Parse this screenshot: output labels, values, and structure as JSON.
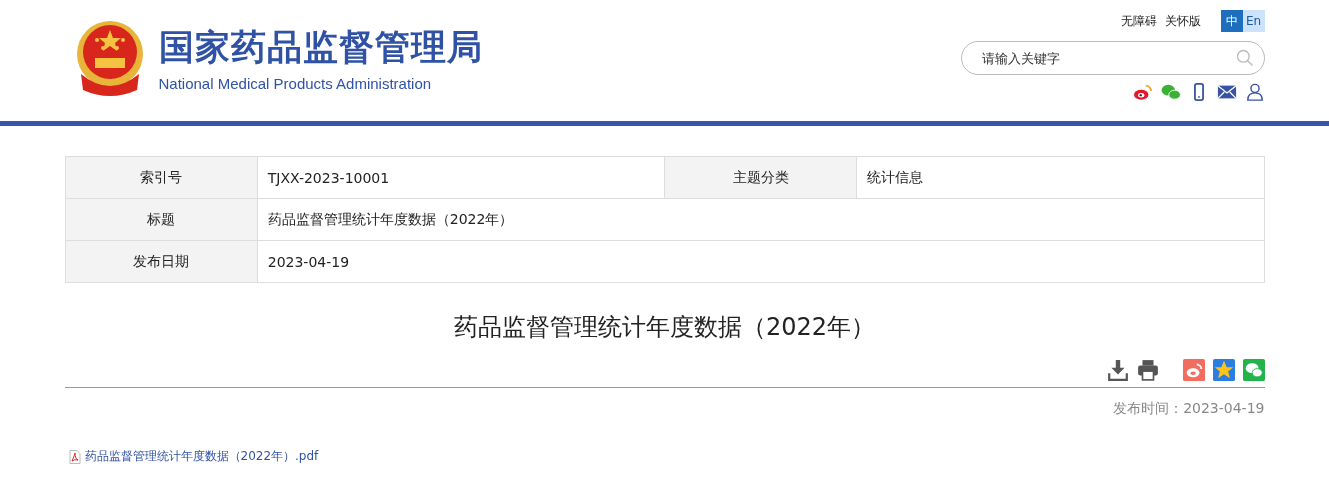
{
  "header": {
    "title": "国家药品监督管理局",
    "subtitle": "National Medical Products Administration",
    "links": [
      "无障碍",
      "关怀版"
    ],
    "languages": [
      {
        "label": "中",
        "selected": true
      },
      {
        "label": "En",
        "selected": false
      }
    ],
    "search": {
      "placeholder": "请输入关键字"
    }
  },
  "info_table": {
    "rows": [
      {
        "cells": [
          {
            "label": "索引号",
            "value": "TJXX-2023-10001"
          },
          {
            "label": "主题分类",
            "value": "统计信息"
          }
        ]
      },
      {
        "cells": [
          {
            "label": "标题",
            "value": "药品监督管理统计年度数据（2022年）"
          }
        ]
      },
      {
        "cells": [
          {
            "label": "发布日期",
            "value": "2023-04-19"
          }
        ]
      }
    ]
  },
  "article": {
    "title": "药品监督管理统计年度数据（2022年）",
    "published_label": "发布时间：",
    "published": "2023-04-19",
    "attachment": "药品监督管理统计年度数据（2022年）.pdf"
  }
}
